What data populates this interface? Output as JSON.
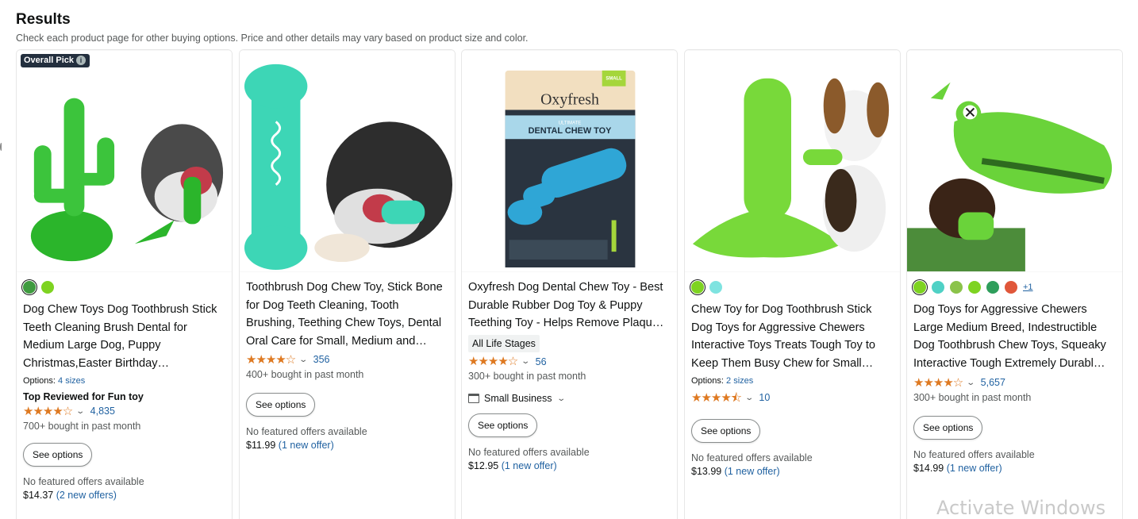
{
  "header": {
    "title": "Results",
    "subtitle": "Check each product page for other buying options. Price and other details may vary based on product size and color."
  },
  "products": [
    {
      "badge": "Overall Pick",
      "swatches": [
        "#3f9b3f",
        "#7ed321"
      ],
      "title": "Dog Chew Toys Dog Toothbrush Stick Teeth Cleaning Brush Dental for Medium Large Dog, Puppy Christmas,Easter Birthday…",
      "options_prefix": "Options: ",
      "options_link": "4 sizes",
      "top_reviewed": "Top Reviewed for Fun toy",
      "rating": 4.0,
      "stars": "★★★★☆",
      "review_count": "4,835",
      "bought": "700+ bought in past month",
      "see_options": "See options",
      "no_offers": "No featured offers available",
      "price": "$14.37",
      "offers": "(2 new offers)"
    },
    {
      "swatches": [],
      "title": "Toothbrush Dog Chew Toy, Stick Bone for Dog Teeth Cleaning, Tooth Brushing, Teething Chew Toys, Dental Oral Care for Small, Medium and…",
      "rating": 4.0,
      "stars": "★★★★☆",
      "review_count": "356",
      "bought": "400+ bought in past month",
      "see_options": "See options",
      "no_offers": "No featured offers available",
      "price": "$11.99",
      "offers": "(1 new offer)"
    },
    {
      "swatches": [],
      "title": "Oxyfresh Dog Dental Chew Toy - Best Durable Rubber Dog Toy & Puppy Teething Toy - Helps Remove Plaqu…",
      "life_stage": "All Life Stages",
      "rating": 4.0,
      "stars": "★★★★☆",
      "review_count": "56",
      "bought": "300+ bought in past month",
      "small_business": "Small Business",
      "see_options": "See options",
      "no_offers": "No featured offers available",
      "price": "$12.95",
      "offers": "(1 new offer)",
      "image_text": {
        "small_tag": "SMALL",
        "brand": "Oxyfresh",
        "ultimate": "ULTIMATE",
        "product": "DENTAL CHEW TOY"
      }
    },
    {
      "swatches": [
        "#7ed321",
        "#7fe3e0"
      ],
      "title": "Chew Toy for Dog Toothbrush Stick Dog Toys for Aggressive Chewers Interactive Toys Treats Tough Toy to Keep Them Busy Chew for Small…",
      "options_prefix": "Options: ",
      "options_link": "2 sizes",
      "rating": 4.5,
      "stars": "★★★★⯪",
      "review_count": "10",
      "see_options": "See options",
      "no_offers": "No featured offers available",
      "price": "$13.99",
      "offers": "(1 new offer)"
    },
    {
      "swatches": [
        "#7ed321",
        "#4fd1c5",
        "#8bc34a",
        "#7ed321",
        "#2e9e5b",
        "#e0573a"
      ],
      "more_swatches": "+1",
      "title": "Dog Toys for Aggressive Chewers Large Medium Breed, Indestructible Dog Toothbrush Chew Toys, Squeaky Interactive Tough Extremely Durabl…",
      "rating": 4.0,
      "stars": "★★★★☆",
      "review_count": "5,657",
      "bought": "300+ bought in past month",
      "see_options": "See options",
      "no_offers": "No featured offers available",
      "price": "$14.99",
      "offers": "(1 new offer)"
    }
  ],
  "watermark": "Activate Windows"
}
